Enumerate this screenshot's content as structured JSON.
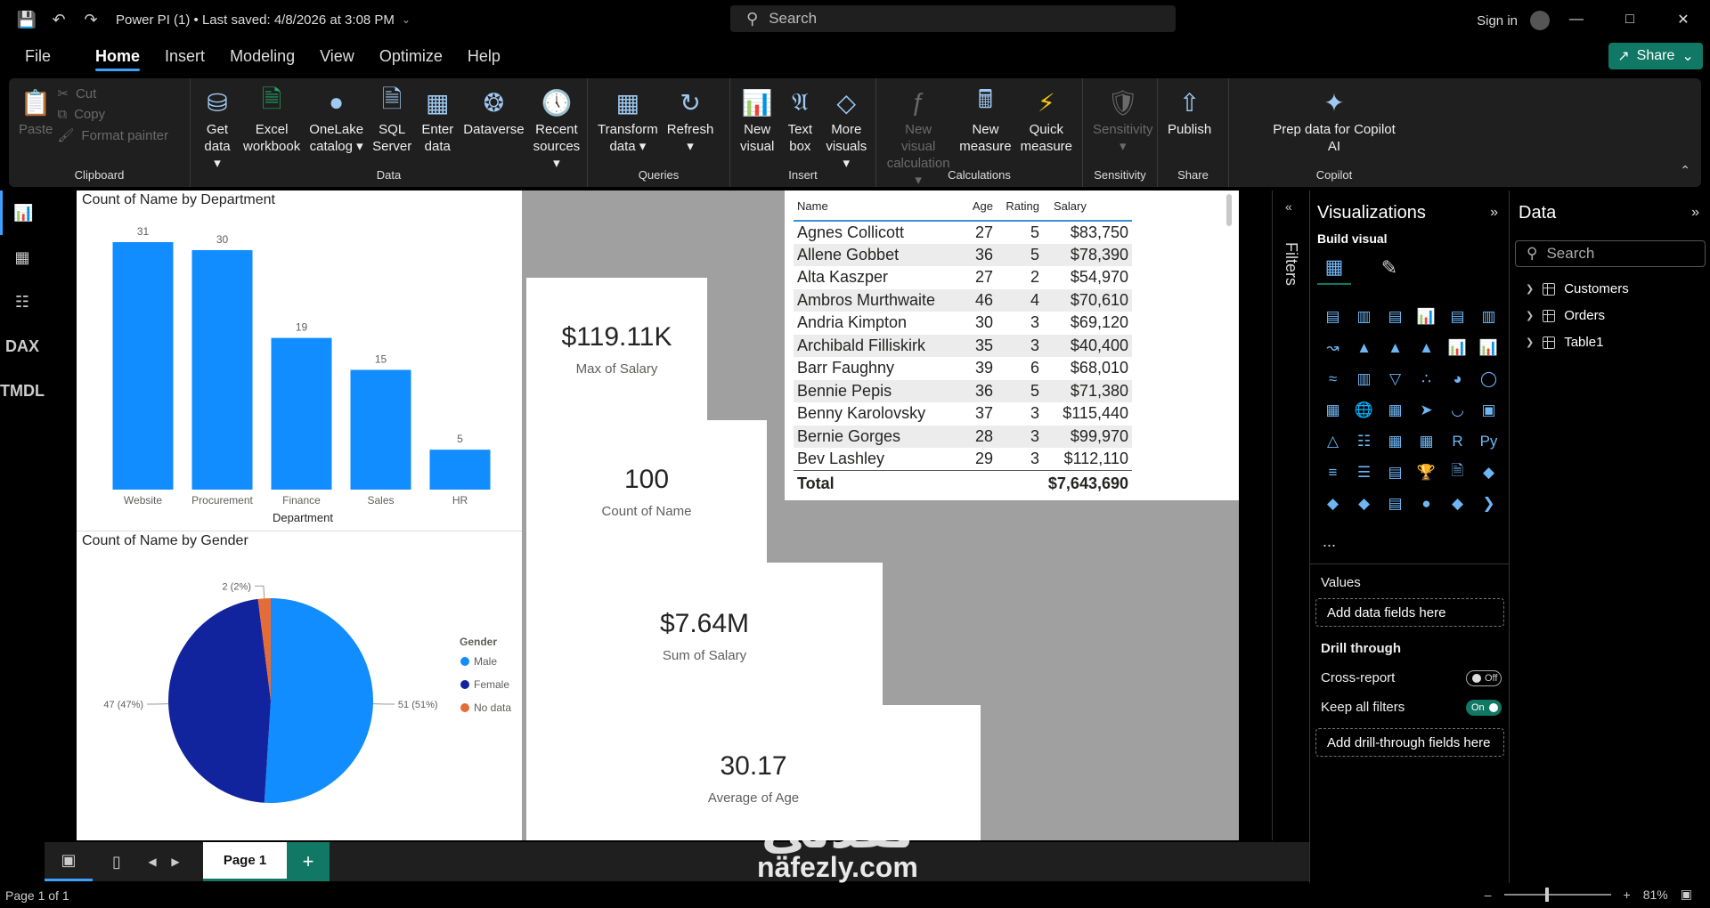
{
  "titlebar": {
    "title": "Power PI (1)  •  Last saved: 4/8/2026 at 3:08 PM",
    "search": "Search",
    "signin": "Sign in"
  },
  "menu": [
    "File",
    "Home",
    "Insert",
    "Modeling",
    "View",
    "Optimize",
    "Help"
  ],
  "share_label": "Share",
  "ribbon": {
    "clipboard": {
      "paste": "Paste",
      "cut": "Cut",
      "copy": "Copy",
      "format_painter": "Format painter",
      "label": "Clipboard"
    },
    "data": {
      "buttons": [
        "Get\ndata ▾",
        "Excel\nworkbook",
        "OneLake\ncatalog ▾",
        "SQL\nServer",
        "Enter\ndata",
        "Dataverse",
        "Recent\nsources ▾"
      ],
      "label": "Data"
    },
    "queries": {
      "buttons": [
        "Transform\ndata ▾",
        "Refresh\n▾"
      ],
      "label": "Queries"
    },
    "insert": {
      "buttons": [
        "New\nvisual",
        "Text\nbox",
        "More\nvisuals ▾"
      ],
      "label": "Insert"
    },
    "calculations": {
      "buttons": [
        "New visual\ncalculation ▾",
        "New\nmeasure",
        "Quick\nmeasure"
      ],
      "label": "Calculations"
    },
    "sensitivity": {
      "buttons": [
        "Sensitivity\n▾"
      ],
      "label": "Sensitivity"
    },
    "share": {
      "buttons": [
        "Publish"
      ],
      "label": "Share"
    },
    "copilot": {
      "buttons": [
        "Prep data for Copilot\nAI"
      ],
      "label": "Copilot"
    }
  },
  "bar_visual": {
    "title": "Count of Name by Department",
    "xlabel": "Department"
  },
  "pie_visual": {
    "title": "Count of Name by Gender",
    "legend_title": "Gender"
  },
  "cards": [
    {
      "value": "$119.11K",
      "label": "Max of Salary"
    },
    {
      "value": "100",
      "label": "Count of Name"
    },
    {
      "value": "$7.64M",
      "label": "Sum of Salary"
    },
    {
      "value": "30.17",
      "label": "Average of Age"
    }
  ],
  "table": {
    "headers": [
      "Name",
      "Age",
      "Rating",
      "Salary"
    ],
    "rows": [
      [
        "Agnes Collicott",
        "27",
        "5",
        "$83,750"
      ],
      [
        "Allene Gobbet",
        "36",
        "5",
        "$78,390"
      ],
      [
        "Alta Kaszper",
        "27",
        "2",
        "$54,970"
      ],
      [
        "Ambros Murthwaite",
        "46",
        "4",
        "$70,610"
      ],
      [
        "Andria Kimpton",
        "30",
        "3",
        "$69,120"
      ],
      [
        "Archibald Filliskirk",
        "35",
        "3",
        "$40,400"
      ],
      [
        "Barr Faughny",
        "39",
        "6",
        "$68,010"
      ],
      [
        "Bennie Pepis",
        "36",
        "5",
        "$71,380"
      ],
      [
        "Benny Karolovsky",
        "37",
        "3",
        "$115,440"
      ],
      [
        "Bernie Gorges",
        "28",
        "3",
        "$99,970"
      ],
      [
        "Bev Lashley",
        "29",
        "3",
        "$112,110"
      ]
    ],
    "total_label": "Total",
    "total_value": "$7,643,690"
  },
  "chart_data": [
    {
      "type": "bar",
      "title": "Count of Name by Department",
      "xlabel": "Department",
      "categories": [
        "Website",
        "Procurement",
        "Finance",
        "Sales",
        "HR"
      ],
      "values": [
        31,
        30,
        19,
        15,
        5
      ],
      "color": "#118dff",
      "ylim": [
        0,
        31
      ]
    },
    {
      "type": "pie",
      "title": "Count of Name by Gender",
      "legend_title": "Gender",
      "categories": [
        "Male",
        "Female",
        "No data"
      ],
      "values": [
        51,
        47,
        2
      ],
      "labels": [
        "51 (51%)",
        "47 (47%)",
        "2 (2%)"
      ],
      "colors": [
        "#118dff",
        "#12239e",
        "#e66c37"
      ],
      "legend_position": "right"
    }
  ],
  "filters_label": "Filters",
  "viz_pane": {
    "title": "Visualizations",
    "build_label": "Build visual",
    "more": "...",
    "values_label": "Values",
    "values_placeholder": "Add data fields here",
    "drill_label": "Drill through",
    "cross_report": "Cross-report",
    "cross_state": "Off",
    "keep_filters": "Keep all filters",
    "keep_state": "On",
    "drill_placeholder": "Add drill-through fields here"
  },
  "data_pane": {
    "title": "Data",
    "search_placeholder": "Search",
    "tables": [
      "Customers",
      "Orders",
      "Table1"
    ]
  },
  "bottom": {
    "page_tab": "Page 1",
    "add": "+"
  },
  "status": {
    "page": "Page 1 of 1",
    "zoom": "81%"
  },
  "watermark": {
    "arabic": "نفذلي",
    "latin": "nafezly.com"
  }
}
